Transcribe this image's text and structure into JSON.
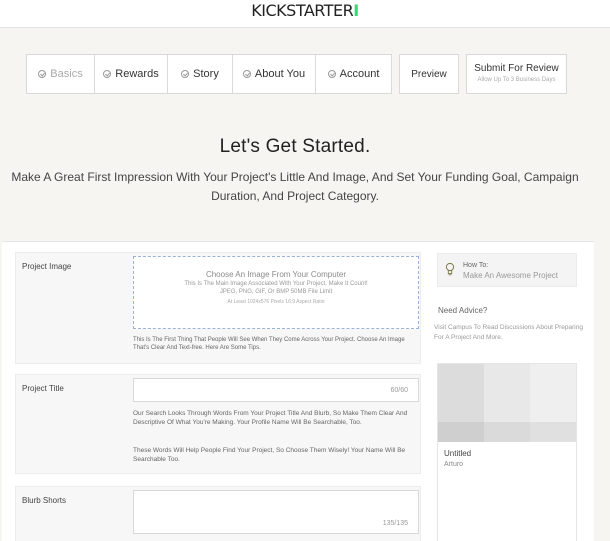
{
  "header": {
    "logo": "KICKSTARTER",
    "logo_accent": "I"
  },
  "steps": [
    {
      "label": "Basics"
    },
    {
      "label": "Rewards"
    },
    {
      "label": "Story"
    },
    {
      "label": "About You"
    },
    {
      "label": "Account"
    }
  ],
  "actions": {
    "preview": "Preview",
    "review": "Submit For Review",
    "review_sub": "Allow Up To 3 Business Days"
  },
  "hero": {
    "title": "Let's Get Started.",
    "subtitle": "Make A Great First Impression With Your Project's Little And Image, And Set Your Funding Goal, Campaign Duration, And Project Category."
  },
  "fields": {
    "image": {
      "label": "Project Image",
      "dropzone_title": "Choose An Image From Your Computer",
      "dropzone_line1": "This Is The Main Image Associated With Your Project. Make It Count!",
      "dropzone_line2": "JPEG, PNG, GIF, Or BMP 50MB File Limit",
      "dropzone_line3": "At Least 1024x576 Pixels 16:9 Aspect Ratio",
      "help": "This Is The First Thing That People Will See When They Come Across Your Project. Choose An Image That's Clear And Text-free. Here Are Some Tips."
    },
    "title": {
      "label": "Project Title",
      "counter": "60/60",
      "help1": "Our Search Looks Through Words From Your Project Title And Blurb, So Make Them Clear And Descriptive Of What You're Making. Your Profile Name Will Be Searchable, Too.",
      "help2": "These Words Will Help People Find Your Project, So Choose Them Wisely! Your Name Will Be Searchable Too."
    },
    "blurb": {
      "label": "Blurb Shorts",
      "counter": "135/135"
    }
  },
  "sidebar": {
    "howto_label": "How To:",
    "howto_link": "Make An Awesome Project",
    "advice_head": "Need Advice?",
    "advice_text": "Visit Campus To Read Discussions About Preparing For A Project And More."
  },
  "card": {
    "title": "Untitled",
    "author": "Arturo"
  }
}
